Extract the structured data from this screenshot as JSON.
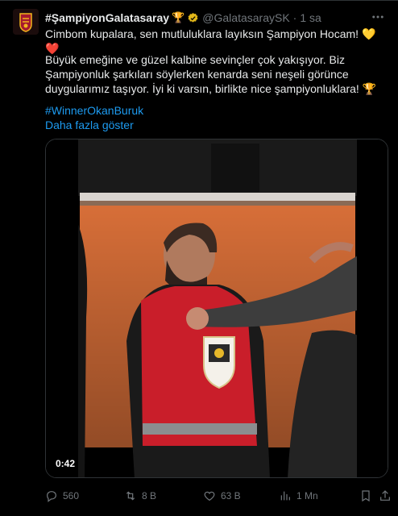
{
  "account": {
    "display_name": "#ŞampiyonGalatasaray",
    "name_emoji": "🏆",
    "handle": "@GalatasaraySK",
    "separator": "·",
    "time": "1 sa",
    "verified_color": "#e2b719"
  },
  "tweet": {
    "line1": "Cimbom kupalara, sen mutluluklara layıksın Şampiyon Hocam! ",
    "line1_emojis": [
      "💛",
      "❤️"
    ],
    "body": "Büyük emeğine ve güzel kalbine sevinçler çok yakışıyor. Biz Şampiyonluk şarkıları söylerken kenarda seni neşeli görünce duygularımız taşıyor. İyi ki varsın, birlikte nice şampiyonluklara! ",
    "body_emoji": "🏆",
    "hashtag": "#WinnerOkanBuruk",
    "show_more": "Daha fazla göster"
  },
  "media": {
    "duration": "0:42",
    "icon": "video-player"
  },
  "actions": {
    "replies": "560",
    "reposts": "8 B",
    "likes": "63 B",
    "views": "1 Mn"
  },
  "colors": {
    "background": "#000000",
    "text": "#e7e9ea",
    "secondary": "#71767b",
    "link": "#1d9bf0",
    "accent_red": "#c8102e"
  }
}
